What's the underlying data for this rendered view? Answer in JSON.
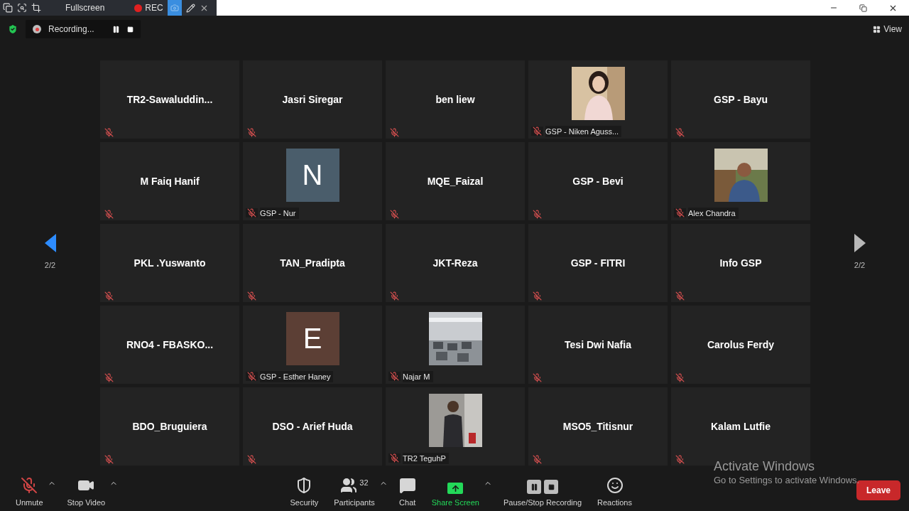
{
  "recorder_toolbar": {
    "fullscreen_label": "Fullscreen",
    "rec_label": "REC",
    "camera_selected": true
  },
  "meeting_bar": {
    "recording_status": "Recording...",
    "view_label": "View"
  },
  "pager": {
    "left": {
      "label": "2/2",
      "disabled": false
    },
    "right": {
      "label": "2/2",
      "disabled": true
    }
  },
  "tiles": [
    {
      "name": "TR2-Sawaluddin...",
      "kind": "name",
      "muted": true
    },
    {
      "name": "Jasri Siregar",
      "kind": "name",
      "muted": true
    },
    {
      "name": "ben liew",
      "kind": "name",
      "muted": true
    },
    {
      "name": "GSP - Niken Aguss...",
      "muted": true
    },
    {
      "name": "GSP - Bayu",
      "kind": "name",
      "muted": true
    },
    {
      "name": "M Faiq Hanif",
      "kind": "name",
      "muted": true
    },
    {
      "name": "GSP - Nur",
      "kind": "initial",
      "initial": "N",
      "color": "#4a5d6b",
      "muted": true
    },
    {
      "name": "MQE_Faizal",
      "kind": "name",
      "muted": true
    },
    {
      "name": "GSP - Bevi",
      "kind": "name",
      "muted": true
    },
    {
      "name": "Alex Chandra",
      "muted": true
    },
    {
      "name": "PKL .Yuswanto",
      "kind": "name",
      "muted": true
    },
    {
      "name": "TAN_Pradipta",
      "kind": "name",
      "muted": true
    },
    {
      "name": "JKT-Reza",
      "kind": "name",
      "muted": true
    },
    {
      "name": "GSP - FITRI",
      "kind": "name",
      "muted": true
    },
    {
      "name": "Info GSP",
      "kind": "name",
      "muted": true
    },
    {
      "name": "RNO4 - FBASKO...",
      "kind": "name",
      "muted": true
    },
    {
      "name": "GSP - Esther Haney",
      "kind": "initial",
      "initial": "E",
      "color": "#5c3f35",
      "muted": true
    },
    {
      "name": "Najar M",
      "muted": true
    },
    {
      "name": "Tesi Dwi Nafia",
      "kind": "name",
      "muted": true
    },
    {
      "name": "Carolus Ferdy",
      "kind": "name",
      "muted": true
    },
    {
      "name": "BDO_Bruguiera",
      "kind": "name",
      "muted": true
    },
    {
      "name": "DSO - Arief Huda",
      "kind": "name",
      "muted": true
    },
    {
      "name": "TR2 TeguhP",
      "muted": true
    },
    {
      "name": "MSO5_Titisnur",
      "kind": "name",
      "muted": true
    },
    {
      "name": "Kalam Lutfie",
      "kind": "name",
      "muted": true
    }
  ],
  "toolbar": [
    {
      "kind": "mic",
      "label": "Unmute",
      "muted": true,
      "caret": true
    },
    {
      "kind": "video",
      "label": "Stop Video",
      "caret": true
    },
    {
      "kind": "spacer"
    },
    {
      "kind": "security",
      "label": "Security"
    },
    {
      "kind": "participants",
      "label": "Participants",
      "count": "32",
      "caret": true
    },
    {
      "kind": "chat",
      "label": "Chat"
    },
    {
      "kind": "share",
      "label": "Share Screen",
      "caret": true
    },
    {
      "kind": "recording",
      "label": "Pause/Stop Recording"
    },
    {
      "kind": "reactions",
      "label": "Reactions"
    }
  ],
  "leave_button": "Leave",
  "os_notice": {
    "title": "Activate Windows",
    "text": "Go to Settings to activate Windows."
  }
}
